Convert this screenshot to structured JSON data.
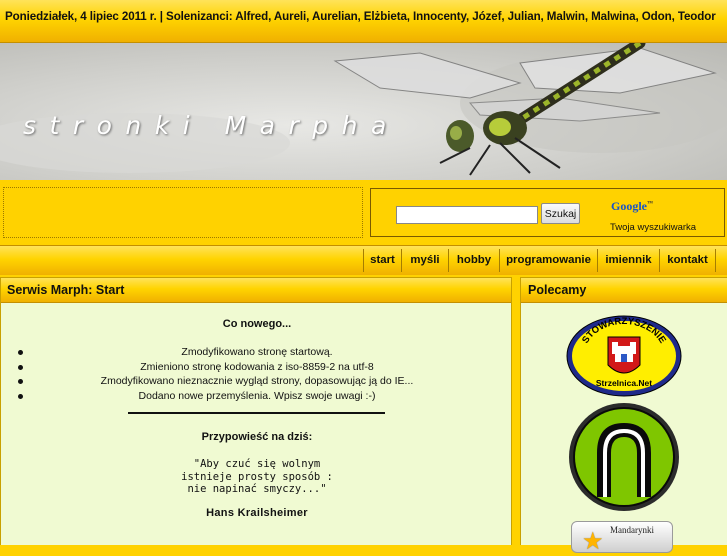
{
  "topbar": {
    "text": "Poniedziałek, 4 lipiec 2011 r. | Solenizanci: Alfred, Aureli, Aurelian, Elżbieta, Innocenty, Józef, Julian, Malwin, Malwina, Odon, Teodor"
  },
  "banner": {
    "title": "stronki Marpha"
  },
  "search": {
    "input_value": "",
    "button_label": "Szukaj",
    "google_logo": "Google",
    "google_tm": "™",
    "subtitle": "Twoja wyszukiwarka"
  },
  "nav": {
    "items": [
      {
        "label": "start"
      },
      {
        "label": "myśli"
      },
      {
        "label": "hobby"
      },
      {
        "label": "programowanie"
      },
      {
        "label": "imiennik"
      },
      {
        "label": "kontakt"
      }
    ]
  },
  "main": {
    "heading": "Serwis Marph: Start",
    "whatsnew_title": "Co nowego...",
    "news": [
      "Zmodyfikowano stronę startową.",
      "Zmieniono stronę kodowania z iso-8859-2 na utf-8",
      "Zmodyfikowano nieznacznie wygląd strony, dopasowując ją do IE...",
      "Dodano nowe przemyślenia. Wpisz swoje uwagi :-)"
    ],
    "proverb_title": "Przypowieść na dziś:",
    "quote_lines": [
      "\"Aby czuć się wolnym",
      "istnieje prosty sposób :",
      "nie napinać smyczy...\""
    ],
    "author": "Hans Krailsheimer"
  },
  "sidebar": {
    "heading": "Polecamy",
    "badge_top_text": "STOWARZYSZENIE",
    "badge_bottom_text": "Strzelnica.Net",
    "mandarynki_label": "Mandarynki"
  },
  "colors": {
    "background": "#ffd200",
    "panel_bg": "#f0fad2",
    "accent_dark": "#c48f00"
  }
}
